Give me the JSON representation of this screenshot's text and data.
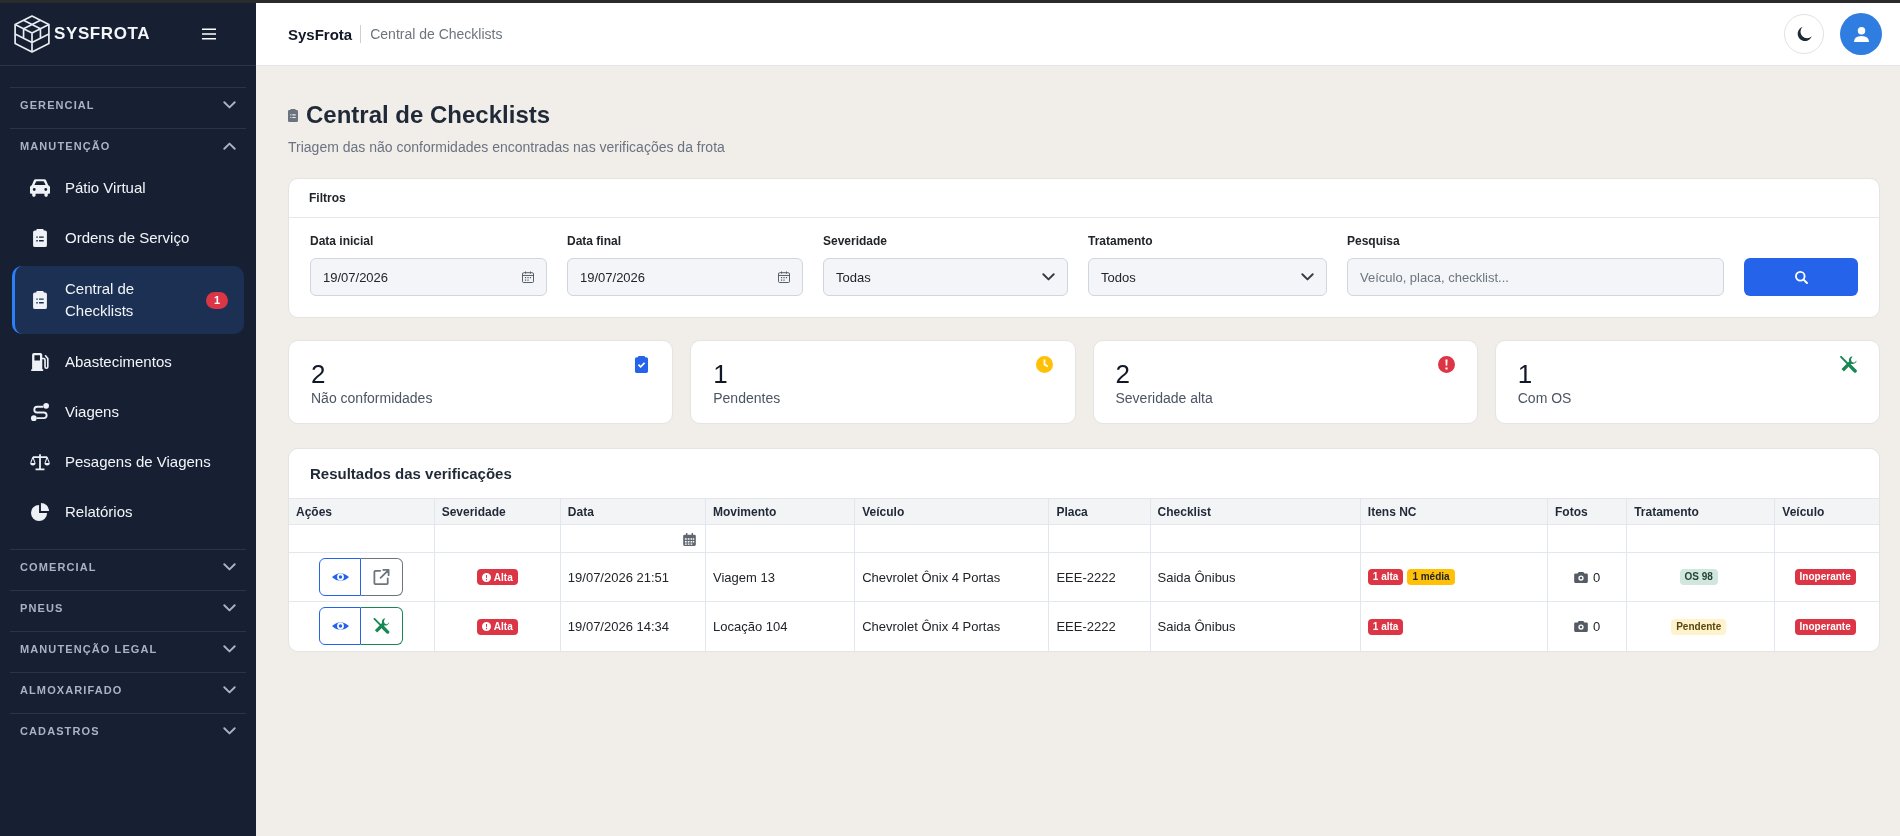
{
  "sidebar": {
    "brand": "SYSFROTA",
    "sections": [
      {
        "title": "GERENCIAL",
        "expanded": false
      },
      {
        "title": "MANUTENÇÃO",
        "expanded": true,
        "items": [
          {
            "label": "Pátio Virtual",
            "selected": false
          },
          {
            "label": "Ordens de Serviço",
            "selected": false
          },
          {
            "label": "Central de Checklists",
            "selected": true,
            "badge": "1"
          },
          {
            "label": "Abastecimentos",
            "selected": false
          },
          {
            "label": "Viagens",
            "selected": false
          },
          {
            "label": "Pesagens de Viagens",
            "selected": false
          },
          {
            "label": "Relatórios",
            "selected": false
          }
        ]
      },
      {
        "title": "COMERCIAL",
        "expanded": false
      },
      {
        "title": "PNEUS",
        "expanded": false
      },
      {
        "title": "MANUTENÇÃO LEGAL",
        "expanded": false
      },
      {
        "title": "ALMOXARIFADO",
        "expanded": false
      },
      {
        "title": "CADASTROS",
        "expanded": false
      }
    ]
  },
  "header": {
    "brand": "SysFrota",
    "breadcrumb": "Central de Checklists"
  },
  "page": {
    "title": "Central de Checklists",
    "subtitle": "Triagem das não conformidades encontradas nas verificações da frota"
  },
  "filters": {
    "title": "Filtros",
    "fields": [
      {
        "kind": "date",
        "label": "Data inicial",
        "value": "19/07/2026"
      },
      {
        "kind": "date",
        "label": "Data final",
        "value": "19/07/2026"
      },
      {
        "kind": "select",
        "label": "Severidade",
        "value": "Todas"
      },
      {
        "kind": "select",
        "label": "Tratamento",
        "value": "Todos"
      },
      {
        "kind": "text",
        "label": "Pesquisa",
        "placeholder": "Veículo, placa, checklist..."
      }
    ]
  },
  "stats": [
    {
      "value": "2",
      "label": "Não conformidades",
      "color": "#2563eb"
    },
    {
      "value": "1",
      "label": "Pendentes",
      "color": "#ffc107"
    },
    {
      "value": "2",
      "label": "Severidade alta",
      "color": "#dc3545"
    },
    {
      "value": "1",
      "label": "Com OS",
      "color": "#198754"
    }
  ],
  "results": {
    "title": "Resultados das verificações",
    "columns": [
      "Ações",
      "Severidade",
      "Data",
      "Movimento",
      "Veículo",
      "Placa",
      "Checklist",
      "Itens NC",
      "Fotos",
      "Tratamento",
      "Veículo"
    ],
    "rows": [
      {
        "actions": [
          {
            "kind": "view"
          },
          {
            "kind": "link"
          }
        ],
        "severity": {
          "label": "Alta",
          "color": "#dc3545"
        },
        "date": "19/07/2026 21:51",
        "movement": "Viagem 13",
        "vehicle": "Chevrolet Ônix 4 Portas",
        "plate": "EEE-2222",
        "checklist": "Saida Ônibus",
        "nc_items": [
          {
            "label": "1 alta",
            "color": "#dc3545"
          },
          {
            "label": "1 média",
            "color": "#ffc107"
          }
        ],
        "photos": "0",
        "treatment": {
          "label": "OS 98",
          "color": "#d1e7dd"
        },
        "vehicle_status": {
          "label": "Inoperante",
          "color": "#dc3545"
        }
      },
      {
        "actions": [
          {
            "kind": "view"
          },
          {
            "kind": "service-order"
          }
        ],
        "severity": {
          "label": "Alta",
          "color": "#dc3545"
        },
        "date": "19/07/2026 14:34",
        "movement": "Locação 104",
        "vehicle": "Chevrolet Ônix 4 Portas",
        "plate": "EEE-2222",
        "checklist": "Saida Ônibus",
        "nc_items": [
          {
            "label": "1 alta",
            "color": "#dc3545"
          }
        ],
        "photos": "0",
        "treatment": {
          "label": "Pendente",
          "color": "#fff3cd"
        },
        "vehicle_status": {
          "label": "Inoperante",
          "color": "#dc3545"
        }
      }
    ]
  }
}
